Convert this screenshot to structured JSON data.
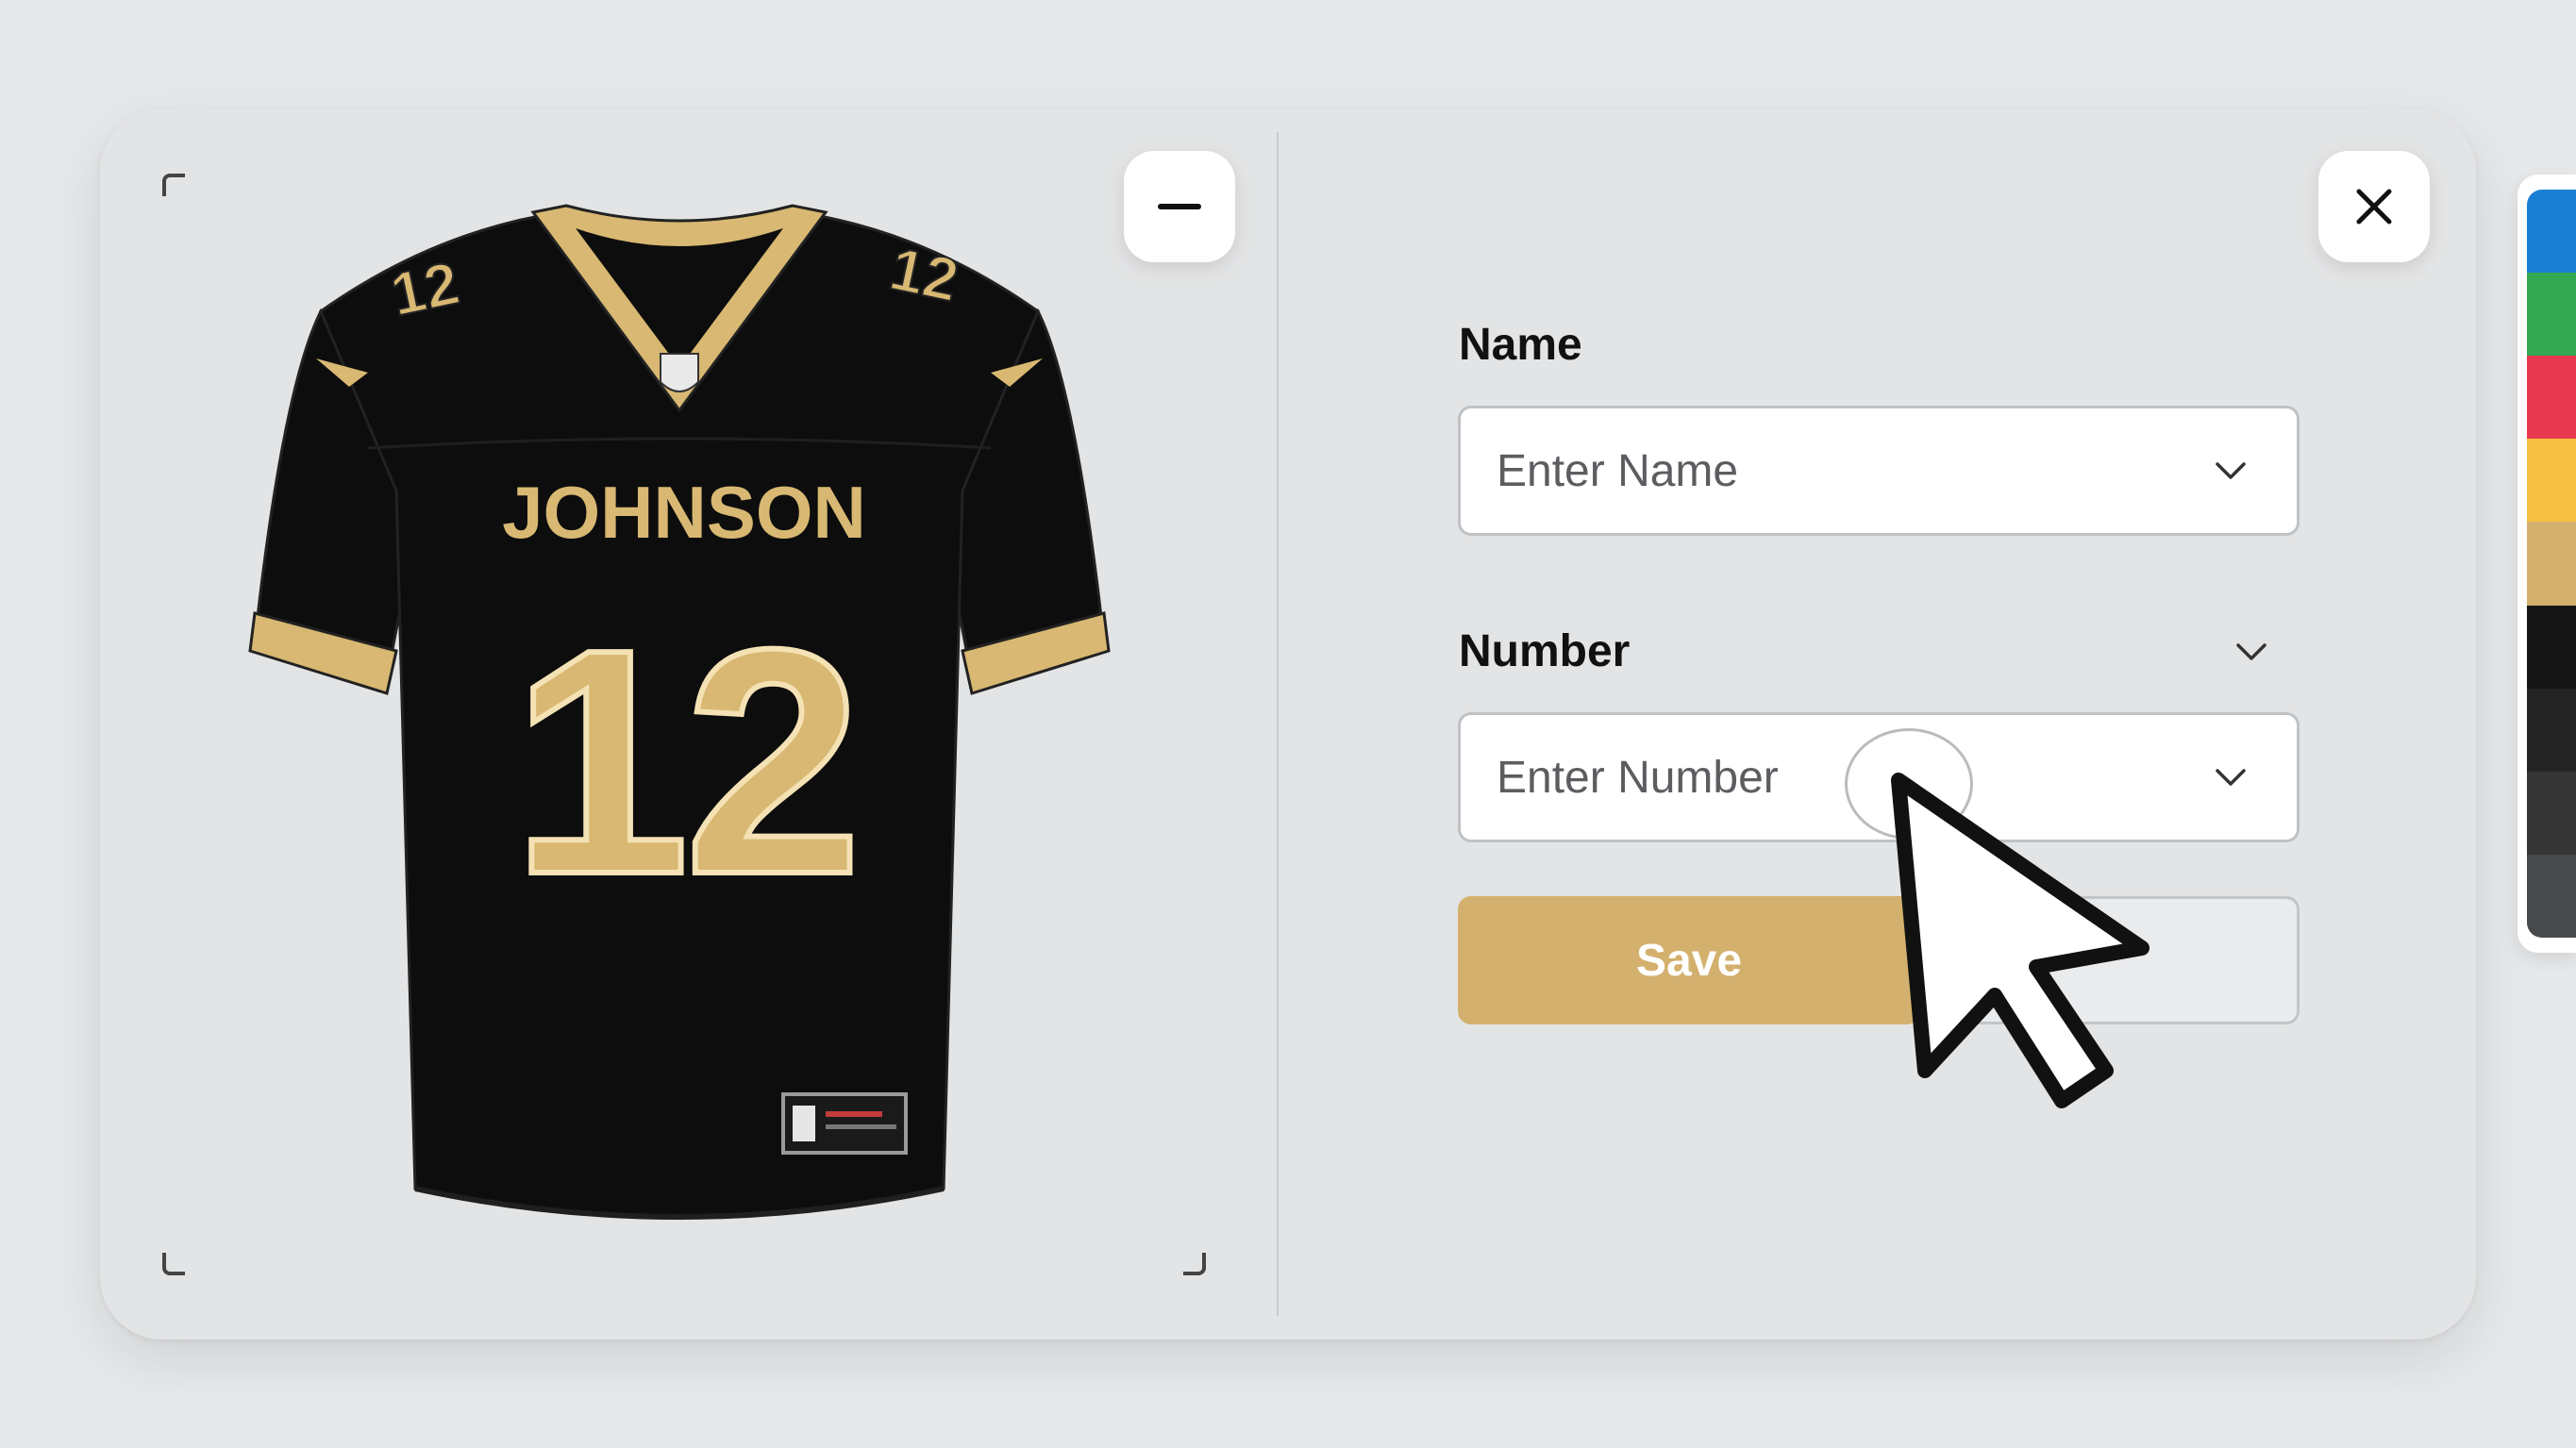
{
  "dialog": {
    "minimize_icon": "minus-icon",
    "close_icon": "close-icon"
  },
  "jersey": {
    "player_name": "JOHNSON",
    "player_number": "12",
    "shoulder_number": "12",
    "body_color": "#0d0d0d",
    "trim_color": "#d8b872"
  },
  "form": {
    "name_label": "Name",
    "name_placeholder": "Enter Name",
    "number_label": "Number",
    "number_placeholder": "Enter Number",
    "save_label": "Save",
    "dropdown_icon": "chevron-down-icon"
  },
  "palette": {
    "colors": [
      "#1a7fd4",
      "#34a853",
      "#e8384f",
      "#f6c142",
      "#d4b06e",
      "#161616",
      "#242424",
      "#353536",
      "#48494b"
    ]
  },
  "accent_color": "#d4b06e"
}
